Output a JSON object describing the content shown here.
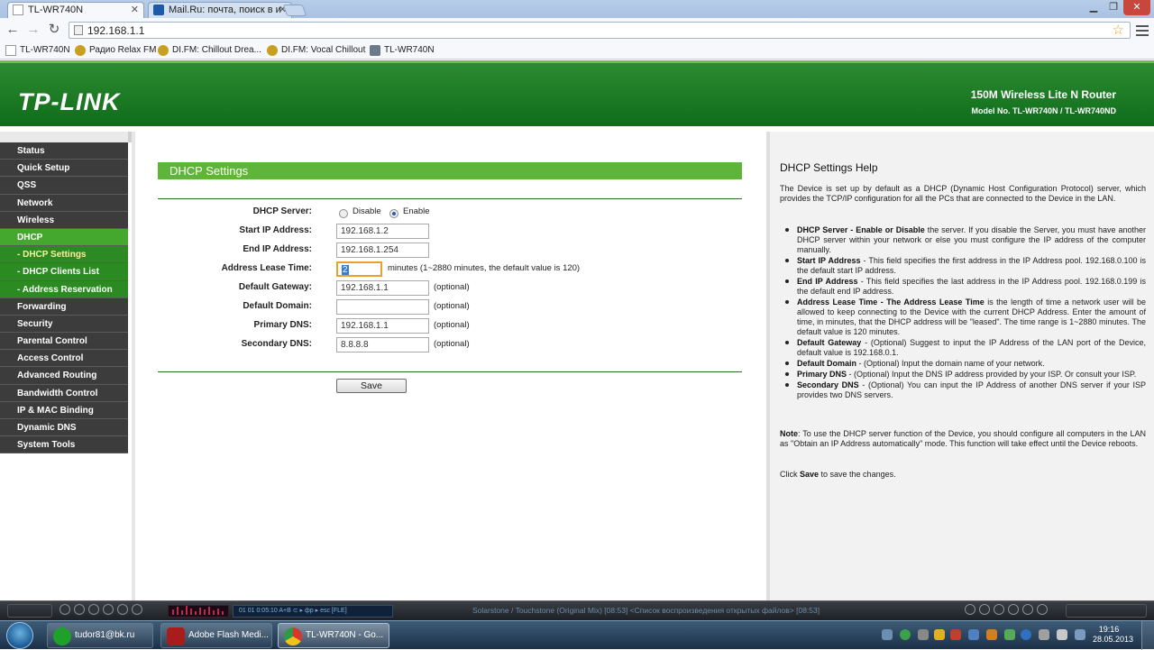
{
  "browser": {
    "tabs": [
      {
        "title": "TL-WR740N",
        "active": true
      },
      {
        "title": "Mail.Ru: почта, поиск в и",
        "active": false
      }
    ],
    "address": "192.168.1.1",
    "bookmarks": [
      "TL-WR740N",
      "Радио Relax FM",
      "DI.FM: Chillout Drea...",
      "DI.FM: Vocal Chillout",
      "TL-WR740N"
    ]
  },
  "header": {
    "logo": "TP-LINK",
    "product": "150M Wireless Lite N Router",
    "model": "Model No. TL-WR740N / TL-WR740ND"
  },
  "sidebar": {
    "items": [
      "Status",
      "Quick Setup",
      "QSS",
      "Network",
      "Wireless",
      "DHCP",
      "- DHCP Settings",
      "- DHCP Clients List",
      "- Address Reservation",
      "Forwarding",
      "Security",
      "Parental Control",
      "Access Control",
      "Advanced Routing",
      "Bandwidth Control",
      "IP & MAC Binding",
      "Dynamic DNS",
      "System Tools"
    ],
    "active": "DHCP",
    "current": "- DHCP Settings"
  },
  "form": {
    "title": "DHCP Settings",
    "dhcp_server_label": "DHCP Server:",
    "disable_label": "Disable",
    "enable_label": "Enable",
    "selected": "Enable",
    "start_ip_label": "Start IP Address:",
    "start_ip": "192.168.1.2",
    "end_ip_label": "End IP Address:",
    "end_ip": "192.168.1.254",
    "lease_label": "Address Lease Time:",
    "lease_value": "2",
    "lease_hint": "minutes (1~2880 minutes, the default value is 120)",
    "gateway_label": "Default Gateway:",
    "gateway": "192.168.1.1",
    "domain_label": "Default Domain:",
    "domain": "",
    "primary_dns_label": "Primary DNS:",
    "primary_dns": "192.168.1.1",
    "secondary_dns_label": "Secondary DNS:",
    "secondary_dns": "8.8.8.8",
    "optional": "(optional)",
    "save_label": "Save"
  },
  "help": {
    "title": "DHCP Settings Help",
    "intro": "The Device is set up by default as a DHCP (Dynamic Host Configuration Protocol) server, which provides the TCP/IP configuration for all the PCs that are connected to the Device in the LAN.",
    "items": [
      {
        "term": "DHCP Server - Enable or Disable",
        "text": " the server. If you disable the Server, you must have another DHCP server within your network or else you must configure the IP address of the computer manually."
      },
      {
        "term": "Start IP Address",
        "text": " - This field specifies the first address in the IP Address pool. 192.168.0.100 is the default start IP address."
      },
      {
        "term": "End IP Address",
        "text": " - This field specifies the last address in the IP Address pool. 192.168.0.199 is the default end IP address."
      },
      {
        "term": "Address Lease Time - The Address Lease Time",
        "text": " is the length of time a network user will be allowed to keep connecting to the Device with the current DHCP Address. Enter the amount of time, in minutes, that the DHCP address will be \"leased\". The time range is 1~2880 minutes. The default value is 120 minutes."
      },
      {
        "term": "Default Gateway",
        "text": " - (Optional) Suggest to input the IP Address of the LAN port of the Device, default value is 192.168.0.1."
      },
      {
        "term": "Default Domain",
        "text": " - (Optional) Input the domain name of your network."
      },
      {
        "term": "Primary DNS",
        "text": " - (Optional) Input the DNS IP address provided by your ISP. Or consult your ISP."
      },
      {
        "term": "Secondary DNS",
        "text": " - (Optional) You can input the IP Address of another DNS server if your ISP provides two DNS servers."
      }
    ],
    "note_label": "Note",
    "note": ": To use the DHCP server function of the Device, you should configure all computers in the LAN as \"Obtain an IP Address automatically\" mode. This function will take effect until the Device reboots.",
    "click_pre": "Click ",
    "click_term": "Save",
    "click_post": " to save the changes."
  },
  "media_player": {
    "track": "Solarstone / Touchstone (Original Mix)  [08:53]    <Список воспроизведения открытых файлов> [08:53]",
    "display": "01   01    0:05:10    A+B ⊂ ▸ фр ▸ esc  [FLE]"
  },
  "taskbar": {
    "buttons": [
      "tudor81@bk.ru",
      "Adobe Flash Medi...",
      "TL-WR740N - Go..."
    ],
    "active": "TL-WR740N - Go...",
    "time": "19:16",
    "date": "28.05.2013"
  },
  "colors": {
    "brand_green": "#2d8b32",
    "title_bar_green": "#5fb43a",
    "menu_dark": "#3c3c3c",
    "menu_active": "#44a82e"
  }
}
